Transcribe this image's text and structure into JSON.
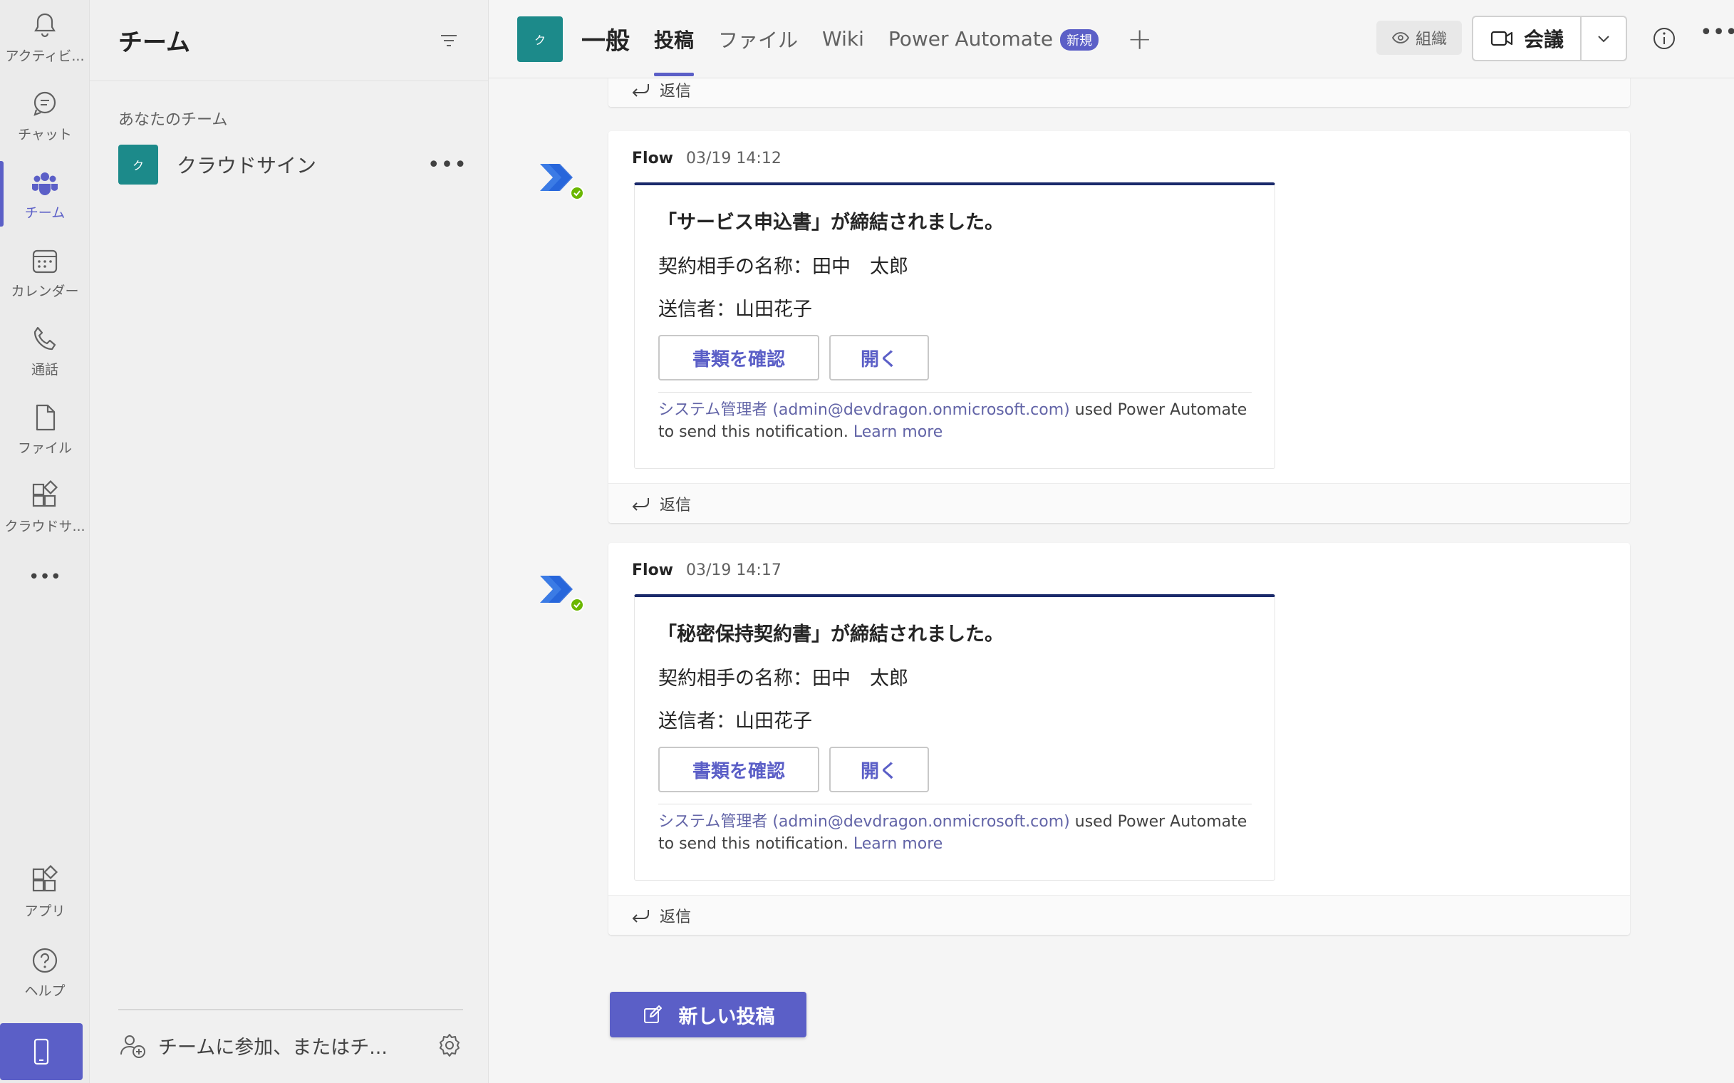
{
  "rail": {
    "items": [
      {
        "label": "アクティビ...",
        "icon": "bell-icon"
      },
      {
        "label": "チャット",
        "icon": "chat-icon"
      },
      {
        "label": "チーム",
        "icon": "teams-icon"
      },
      {
        "label": "カレンダー",
        "icon": "calendar-icon"
      },
      {
        "label": "通話",
        "icon": "phone-icon"
      },
      {
        "label": "ファイル",
        "icon": "file-icon"
      },
      {
        "label": "クラウドサ...",
        "icon": "app-icon"
      }
    ],
    "more": "•••",
    "bottom_items": [
      {
        "label": "アプリ",
        "icon": "apps-icon"
      },
      {
        "label": "ヘルプ",
        "icon": "help-icon"
      }
    ]
  },
  "panel": {
    "title": "チーム",
    "section_label": "あなたのチーム",
    "team": {
      "avatar": "ク",
      "name": "クラウドサイン",
      "more": "•••"
    },
    "join_text": "チームに参加、またはチ..."
  },
  "topbar": {
    "channel_avatar": "ク",
    "channel_name": "一般",
    "tabs": [
      "投稿",
      "ファイル",
      "Wiki",
      "Power Automate"
    ],
    "new_badge": "新規",
    "org_label": "組織",
    "meet_label": "会議"
  },
  "feed": {
    "top_reply": "返信",
    "messages": [
      {
        "sender": "Flow",
        "time": "03/19 14:12",
        "title": "「サービス申込書」が締結されました。",
        "counterparty": "契約相手の名称：田中　太郎",
        "sender_line": "送信者：山田花子",
        "btn_check": "書類を確認",
        "btn_open": "開く",
        "note_link": "システム管理者 (admin@devdragon.onmicrosoft.com)",
        "note_text": " used Power Automate to send this notification. ",
        "note_learn": "Learn more",
        "reply": "返信"
      },
      {
        "sender": "Flow",
        "time": "03/19 14:17",
        "title": "「秘密保持契約書」が締結されました。",
        "counterparty": "契約相手の名称：田中　太郎",
        "sender_line": "送信者：山田花子",
        "btn_check": "書類を確認",
        "btn_open": "開く",
        "note_link": "システム管理者 (admin@devdragon.onmicrosoft.com)",
        "note_text": " used Power Automate to send this notification. ",
        "note_learn": "Learn more",
        "reply": "返信"
      }
    ],
    "new_post": "新しい投稿"
  },
  "colors": {
    "accent": "#5b5fc7",
    "team_avatar": "#1c8a8a",
    "card_top_border": "#1b2a6b",
    "link": "#6264a7"
  }
}
